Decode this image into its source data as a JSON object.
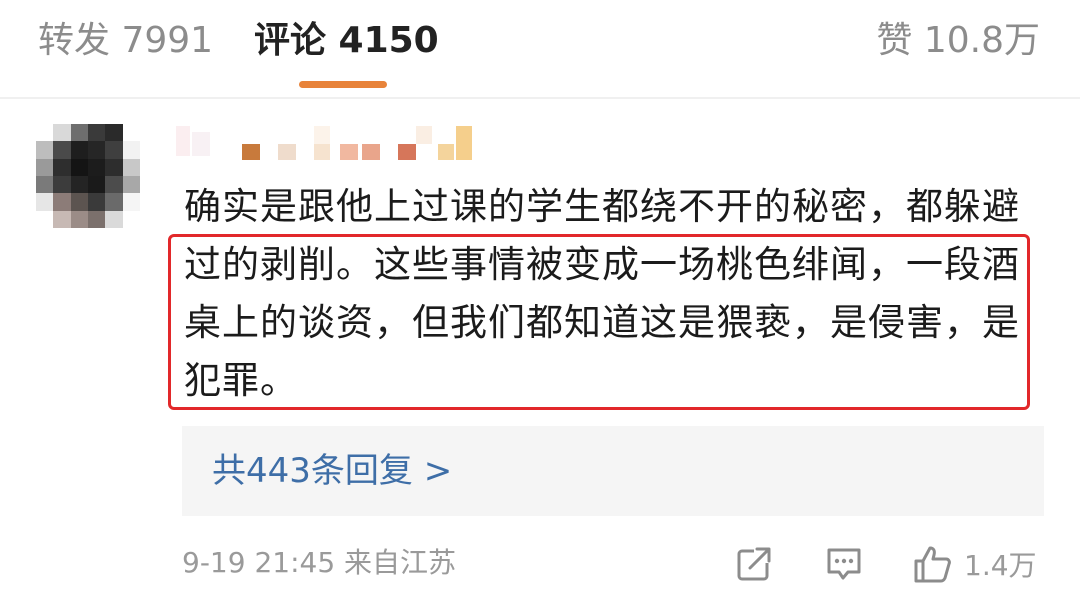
{
  "tabs": {
    "repost": "转发 7991",
    "comment": "评论 4150",
    "like": "赞 10.8万"
  },
  "comment": {
    "username_obscured": true,
    "text": "确实是跟他上过课的学生都绕不开的秘密，都躲避过的剥削。这些事情被变成一场桃色绯闻，一段酒桌上的谈资，但我们都知道这是猥亵，是侵害，是犯罪。",
    "replies_link": "共443条回复 >",
    "meta": "9-19 21:45 来自江苏",
    "like_count": "1.4万",
    "icons": [
      "share-icon",
      "reply-comment-icon",
      "thumbs-up-icon"
    ],
    "highlight_color": "#e2282a",
    "link_color": "#3e6ea7",
    "accent_color": "#e8833a"
  }
}
